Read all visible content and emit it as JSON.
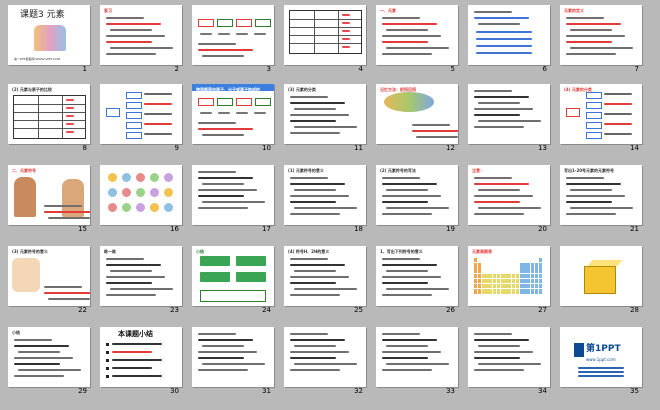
{
  "window": {
    "title": "课题3 元素",
    "view": "slide-sorter"
  },
  "slides": [
    {
      "n": "1",
      "kind": "title",
      "title": "课题3 元素",
      "footer": "第一PPT模板网-WWW.1PPT.COM"
    },
    {
      "n": "2",
      "kind": "lines",
      "title": "复习",
      "accent": "#e23b3b"
    },
    {
      "n": "3",
      "kind": "diagram",
      "title": "",
      "accent": "#2e7d32"
    },
    {
      "n": "4",
      "kind": "table",
      "title": "",
      "accent": "#333333"
    },
    {
      "n": "5",
      "kind": "lines",
      "title": "一、元素",
      "accent": "#e23b3b"
    },
    {
      "n": "6",
      "kind": "formula",
      "title": "",
      "accent": "#3e74d6"
    },
    {
      "n": "7",
      "kind": "lines",
      "title": "元素的定义",
      "accent": "#e23b3b"
    },
    {
      "n": "8",
      "kind": "table",
      "title": "(2) 元素与原子的比较",
      "accent": "#333333"
    },
    {
      "n": "9",
      "kind": "tree",
      "title": "",
      "accent": "#3e74d6"
    },
    {
      "n": "10",
      "kind": "diagram",
      "title": "物质都是由原子、分子或离子构成的",
      "accent": "#1e6bd1"
    },
    {
      "n": "11",
      "kind": "lines",
      "title": "(3) 元素的分类",
      "accent": "#333333"
    },
    {
      "n": "12",
      "kind": "image",
      "title": "记忆方法：前拐后拐",
      "accent": "#e23b3b"
    },
    {
      "n": "13",
      "kind": "lines",
      "title": "",
      "accent": "#333333"
    },
    {
      "n": "14",
      "kind": "tree",
      "title": "(4) 元素的分类",
      "accent": "#e23b3b"
    },
    {
      "n": "15",
      "kind": "image",
      "title": "二、元素符号",
      "accent": "#e23b3b"
    },
    {
      "n": "16",
      "kind": "grid",
      "title": "",
      "accent": "#7b7bff"
    },
    {
      "n": "17",
      "kind": "lines",
      "title": "",
      "accent": "#333333"
    },
    {
      "n": "18",
      "kind": "lines",
      "title": "(1) 元素符号的意义",
      "accent": "#333333"
    },
    {
      "n": "19",
      "kind": "lines",
      "title": "(2) 元素符号的写法",
      "accent": "#333333"
    },
    {
      "n": "20",
      "kind": "lines",
      "title": "注意：",
      "accent": "#e23b3b"
    },
    {
      "n": "21",
      "kind": "lines",
      "title": "写出1-20号元素的元素符号",
      "accent": "#333333"
    },
    {
      "n": "22",
      "kind": "image",
      "title": "(3) 元素符号的意义",
      "accent": "#333333"
    },
    {
      "n": "23",
      "kind": "lines",
      "title": "练一练",
      "accent": "#333333"
    },
    {
      "n": "24",
      "kind": "flow",
      "title": "小结",
      "accent": "#2e7d32"
    },
    {
      "n": "25",
      "kind": "lines",
      "title": "(4) 符号H、2H的意义",
      "accent": "#333333"
    },
    {
      "n": "26",
      "kind": "lines",
      "title": "1、写出下列符号的意义",
      "accent": "#333333"
    },
    {
      "n": "27",
      "kind": "periodic",
      "title": "元素周期表",
      "accent": "#e23b3b"
    },
    {
      "n": "28",
      "kind": "box3d",
      "title": "",
      "accent": "#e8a900"
    },
    {
      "n": "29",
      "kind": "lines",
      "title": "小结",
      "accent": "#333333"
    },
    {
      "n": "30",
      "kind": "summary",
      "title": "本课题小结",
      "accent": "#111111"
    },
    {
      "n": "31",
      "kind": "lines",
      "title": "",
      "accent": "#333333"
    },
    {
      "n": "32",
      "kind": "lines",
      "title": "",
      "accent": "#333333"
    },
    {
      "n": "33",
      "kind": "lines",
      "title": "",
      "accent": "#333333"
    },
    {
      "n": "34",
      "kind": "lines",
      "title": "",
      "accent": "#333333"
    },
    {
      "n": "35",
      "kind": "brand",
      "title": "第1PPT",
      "subtitle": "www.1ppt.com",
      "accent": "#0c4a93"
    }
  ]
}
